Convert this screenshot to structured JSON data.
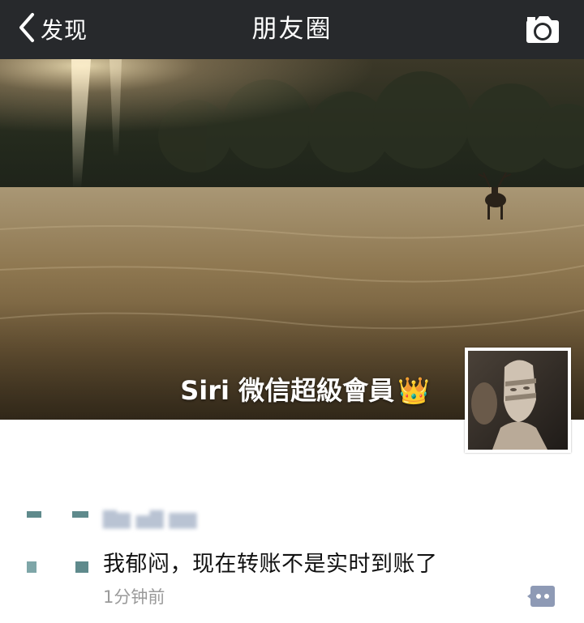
{
  "nav": {
    "back_label": "发现",
    "title": "朋友圈"
  },
  "cover": {
    "user_name": "Siri 微信超級會員",
    "crown_emoji": "👑"
  },
  "post": {
    "text": "我郁闷，现在转账不是实时到账了",
    "time": "1分钟前"
  },
  "colors": {
    "navbar": "#27292c",
    "author_link": "#576b95",
    "comment_button": "#8e9ab5"
  },
  "icons": [
    "chevron-left-icon",
    "camera-icon",
    "comment-icon"
  ]
}
